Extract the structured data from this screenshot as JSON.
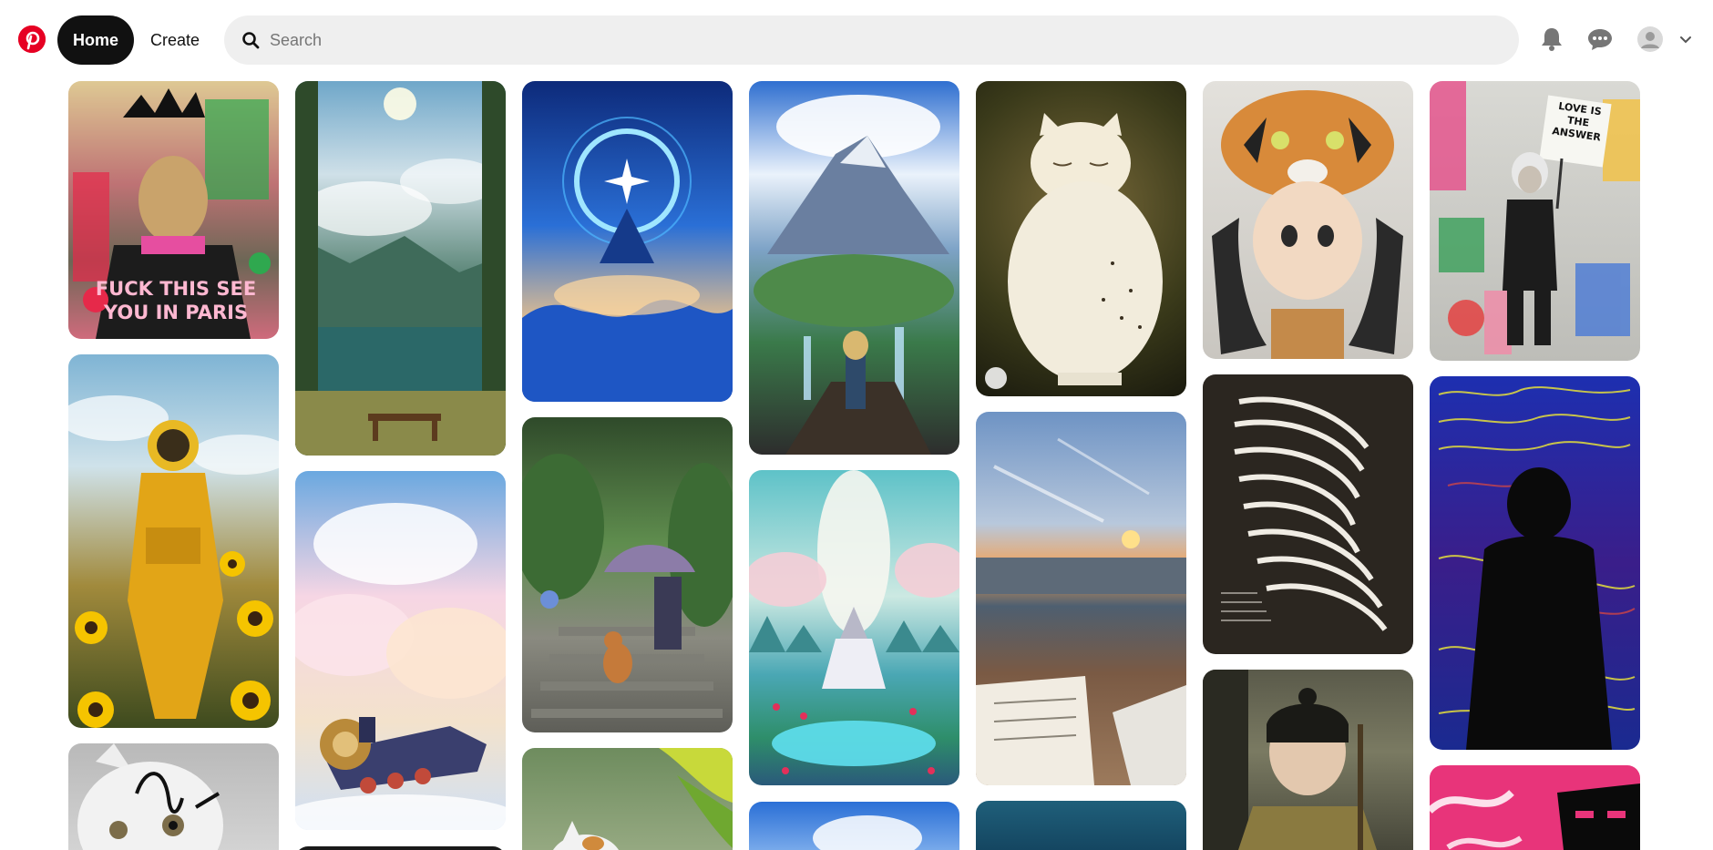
{
  "header": {
    "home_label": "Home",
    "create_label": "Create",
    "search_placeholder": "Search"
  },
  "pins": [
    {
      "id": "pin-1",
      "subject": "graffiti-mona-lisa",
      "caption": "FUCK THIS SEE YOU IN PARIS"
    },
    {
      "id": "pin-2",
      "subject": "astronaut-in-sunflowers"
    },
    {
      "id": "pin-3",
      "subject": "cat-with-drawn-eyebrows"
    },
    {
      "id": "pin-4",
      "subject": "lake-with-bench-anime"
    },
    {
      "id": "pin-5",
      "subject": "steam-train-in-clouds"
    },
    {
      "id": "pin-6",
      "subject": "blue-cosmic-wave"
    },
    {
      "id": "pin-7",
      "subject": "old-man-umbrella-dog-stairs"
    },
    {
      "id": "pin-8",
      "subject": "cat-with-leaves"
    },
    {
      "id": "pin-9",
      "subject": "anime-mountain-adventurer"
    },
    {
      "id": "pin-10",
      "subject": "witch-in-meadow"
    },
    {
      "id": "pin-11",
      "subject": "blue-sky-bottom"
    },
    {
      "id": "pin-12",
      "subject": "white-owl-cat"
    },
    {
      "id": "pin-13",
      "subject": "beach-sunset-with-book"
    },
    {
      "id": "pin-14",
      "subject": "blue-feather-bottom"
    },
    {
      "id": "pin-15",
      "subject": "girl-with-tiger-hat"
    },
    {
      "id": "pin-16",
      "subject": "zebra-striped-face-print"
    },
    {
      "id": "pin-17",
      "subject": "child-samurai"
    },
    {
      "id": "pin-18",
      "subject": "einstein-love-is-the-answer",
      "caption": "LOVE IS THE ANSWER"
    },
    {
      "id": "pin-19",
      "subject": "silhouette-on-graffiti-text"
    },
    {
      "id": "pin-20",
      "subject": "pink-graffiti-face"
    }
  ]
}
